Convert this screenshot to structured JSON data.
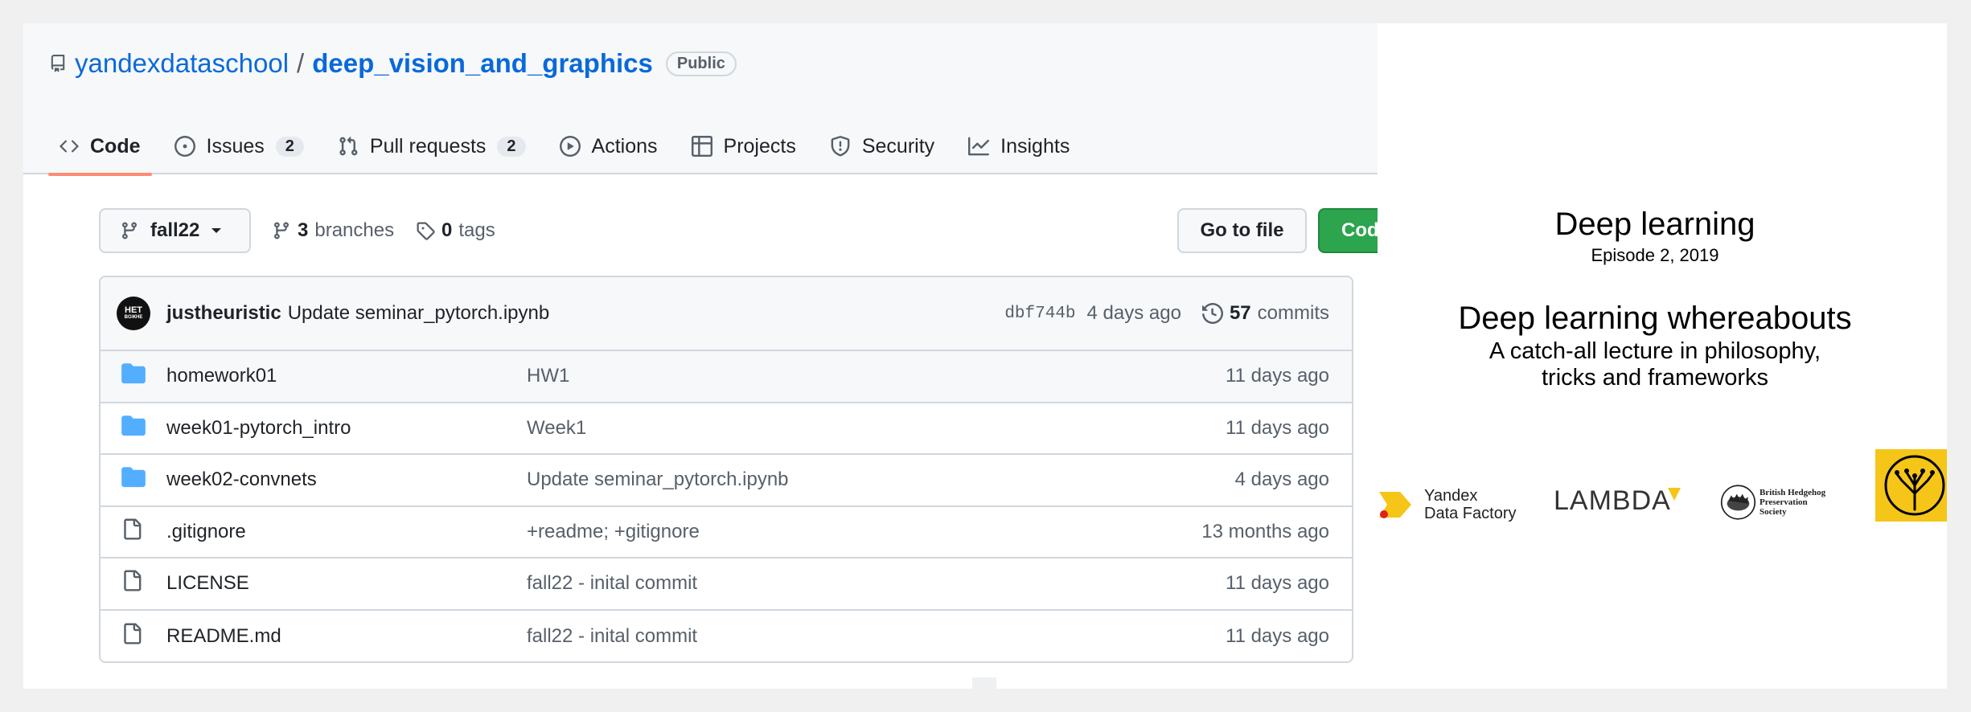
{
  "repo": {
    "owner": "yandexdataschool",
    "separator": "/",
    "name": "deep_vision_and_graphics",
    "visibility": "Public"
  },
  "tabs": [
    {
      "label": "Code",
      "icon": "code-icon",
      "active": true
    },
    {
      "label": "Issues",
      "count": "2",
      "icon": "issue-opened-icon"
    },
    {
      "label": "Pull requests",
      "count": "2",
      "icon": "git-pull-request-icon"
    },
    {
      "label": "Actions",
      "icon": "play-icon"
    },
    {
      "label": "Projects",
      "icon": "table-icon"
    },
    {
      "label": "Security",
      "icon": "shield-icon"
    },
    {
      "label": "Insights",
      "icon": "graph-icon"
    }
  ],
  "toolbar": {
    "branch": "fall22",
    "branches_count": "3",
    "branches_label": "branches",
    "tags_count": "0",
    "tags_label": "tags",
    "go_to_file": "Go to file",
    "code_button": "Code"
  },
  "latest_commit": {
    "avatar_text": "HET",
    "avatar_subtext": "BOЖНЕ",
    "author": "justheuristic",
    "message": "Update seminar_pytorch.ipynb",
    "sha": "dbf744b",
    "age": "4 days ago",
    "commits_count": "57",
    "commits_label": "commits"
  },
  "files": [
    {
      "type": "dir",
      "name": "homework01",
      "message": "HW1",
      "age": "11 days ago"
    },
    {
      "type": "dir",
      "name": "week01-pytorch_intro",
      "message": "Week1",
      "age": "11 days ago"
    },
    {
      "type": "dir",
      "name": "week02-convnets",
      "message": "Update seminar_pytorch.ipynb",
      "age": "4 days ago"
    },
    {
      "type": "file",
      "name": ".gitignore",
      "message": "+readme; +gitignore",
      "age": "13 months ago"
    },
    {
      "type": "file",
      "name": "LICENSE",
      "message": "fall22 - inital commit",
      "age": "11 days ago"
    },
    {
      "type": "file",
      "name": "README.md",
      "message": "fall22 - inital commit",
      "age": "11 days ago"
    }
  ],
  "slide": {
    "title": "Deep learning",
    "episode": "Episode 2, 2019",
    "heading": "Deep learning whereabouts",
    "subtitle_line1": "A catch-all lecture in philosophy,",
    "subtitle_line2": "tricks and frameworks",
    "logos": {
      "ydf_line1": "Yandex",
      "ydf_line2": "Data Factory",
      "lambda": "LAMBDA",
      "hedgehog_line1": "British Hedgehog",
      "hedgehog_line2": "Preservation Society"
    }
  },
  "colors": {
    "link": "#0969da",
    "green_button": "#2da44e",
    "active_tab_underline": "#fd8c73",
    "folder": "#54aeff",
    "logo_yellow": "#f5c518"
  }
}
